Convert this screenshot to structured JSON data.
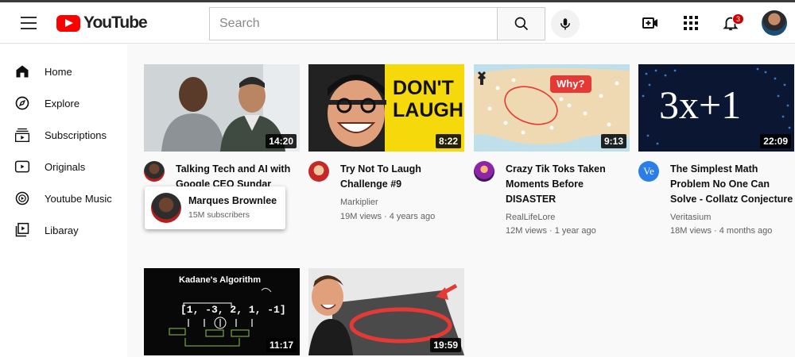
{
  "header": {
    "logo_text": "YouTube",
    "search_placeholder": "Search",
    "notification_count": "3"
  },
  "sidebar": {
    "items": [
      {
        "label": "Home",
        "icon": "home-icon"
      },
      {
        "label": "Explore",
        "icon": "compass-icon"
      },
      {
        "label": "Subscriptions",
        "icon": "subscriptions-icon"
      },
      {
        "label": "Originals",
        "icon": "originals-icon"
      },
      {
        "label": "Youtube Music",
        "icon": "music-icon"
      },
      {
        "label": "Libaray",
        "icon": "library-icon"
      }
    ]
  },
  "videos": [
    {
      "title": "Talking Tech and AI with Google CEO Sundar Pichai!",
      "channel": "Marques Brownlee",
      "stats": "",
      "duration": "14:20"
    },
    {
      "title": "Try Not To Laugh Challenge #9",
      "channel": "Markiplier",
      "stats": "19M views · 4 years ago",
      "duration": "8:22",
      "thumb_text_1": "DON'T",
      "thumb_text_2": "LAUGH"
    },
    {
      "title": "Crazy Tik Toks Taken Moments Before DISASTER",
      "channel": "RealLifeLore",
      "stats": "12M views · 1 year ago",
      "duration": "9:13",
      "thumb_text": "Why?"
    },
    {
      "title": "The Simplest Math Problem No One Can Solve - Collatz Conjecture",
      "channel": "Veritasium",
      "stats": "18M views · 4 months ago",
      "duration": "22:09",
      "thumb_text": "3x+1",
      "avatar_text": "Ve"
    },
    {
      "title": "",
      "channel": "",
      "stats": "",
      "duration": "11:17",
      "thumb_text": "Kadane's Algorithm",
      "thumb_array": "[1, -3, 2, 1, -1]"
    },
    {
      "title": "",
      "channel": "",
      "stats": "",
      "duration": "19:59"
    }
  ],
  "hover_card": {
    "name": "Marques Brownlee",
    "subscribers": "15M subscribers"
  },
  "colors": {
    "brand_red": "#ff0000",
    "badge_red": "#cc0000",
    "text_secondary": "#606060"
  }
}
